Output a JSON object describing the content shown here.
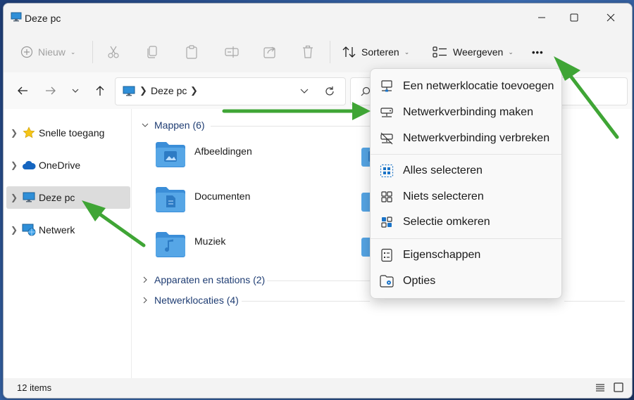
{
  "window": {
    "title": "Deze pc"
  },
  "toolbar": {
    "new_label": "Nieuw",
    "sort_label": "Sorteren",
    "view_label": "Weergeven",
    "more_label": "•••"
  },
  "address": {
    "location": "Deze pc"
  },
  "sidebar": {
    "items": [
      {
        "label": "Snelle toegang"
      },
      {
        "label": "OneDrive"
      },
      {
        "label": "Deze pc"
      },
      {
        "label": "Netwerk"
      }
    ]
  },
  "main": {
    "groups": [
      {
        "label": "Mappen (6)"
      },
      {
        "label": "Apparaten en stations (2)"
      },
      {
        "label": "Netwerklocaties (4)"
      }
    ],
    "folders": [
      {
        "label": "Afbeeldingen",
        "icon": "picture-icon"
      },
      {
        "label": "Documenten",
        "icon": "document-icon"
      },
      {
        "label": "Muziek",
        "icon": "music-icon"
      }
    ]
  },
  "menu": {
    "items": [
      {
        "label": "Een netwerklocatie toevoegen",
        "icon": "network-location-icon"
      },
      {
        "label": "Netwerkverbinding maken",
        "icon": "map-drive-icon"
      },
      {
        "label": "Netwerkverbinding verbreken",
        "icon": "disconnect-drive-icon"
      },
      {
        "label": "Alles selecteren",
        "icon": "select-all-icon"
      },
      {
        "label": "Niets selecteren",
        "icon": "select-none-icon"
      },
      {
        "label": "Selectie omkeren",
        "icon": "invert-selection-icon"
      },
      {
        "label": "Eigenschappen",
        "icon": "properties-icon"
      },
      {
        "label": "Opties",
        "icon": "options-icon"
      }
    ]
  },
  "status": {
    "count": "12 items"
  },
  "colors": {
    "folder": "#56a6e6",
    "accent": "#0067c0",
    "annotation_arrow": "#3fa535"
  }
}
